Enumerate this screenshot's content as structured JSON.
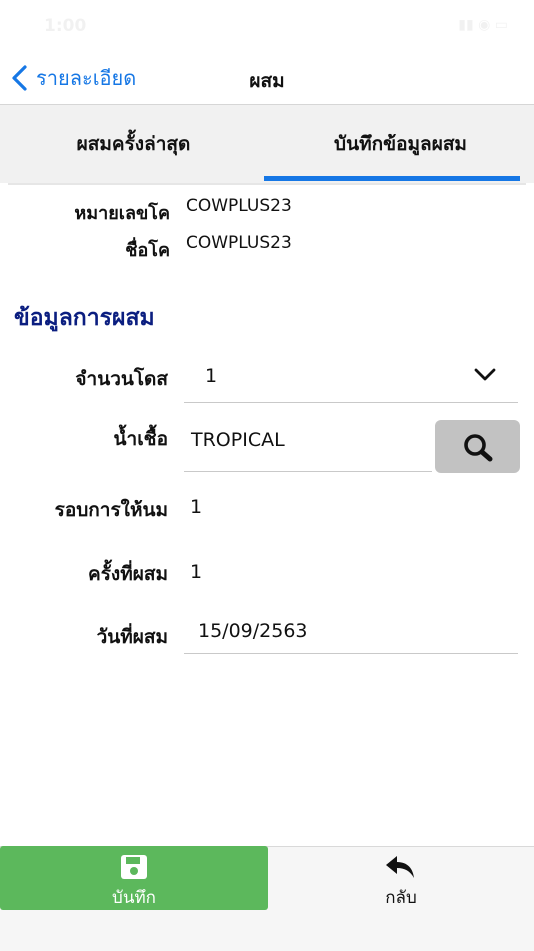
{
  "status_bar": {
    "time": "1:00",
    "indicators": "▮▮ ◉ ▭"
  },
  "nav": {
    "back_label": "รายละเอียด",
    "title": "ผสม"
  },
  "tabs": [
    {
      "label": "ผสมครั้งล่าสุด"
    },
    {
      "label": "บันทึกข้อมูลผสม"
    }
  ],
  "cow": {
    "number_label": "หมายเลขโค",
    "number_value": "COWPLUS23",
    "name_label": "ชื่อโค",
    "name_value": "COWPLUS23"
  },
  "section_title": "ข้อมูลการผสม",
  "form": {
    "doses_label": "จำนวนโดส",
    "doses_value": "1",
    "semen_label": "น้ำเชื้อ",
    "semen_value": "TROPICAL",
    "lactation_label": "รอบการให้นม",
    "lactation_value": "1",
    "breeding_count_label": "ครั้งที่ผสม",
    "breeding_count_value": "1",
    "date_label": "วันที่ผสม",
    "date_value": "15/09/2563"
  },
  "bottom": {
    "save_label": "บันทึก",
    "back_label": "กลับ"
  },
  "colors": {
    "accent": "#1677e5",
    "section": "#0b1e80",
    "save": "#5cb85c"
  },
  "icons": [
    "chevron-left-icon",
    "chevron-down-icon",
    "search-icon",
    "floppy-disk-icon",
    "reply-arrow-icon"
  ]
}
